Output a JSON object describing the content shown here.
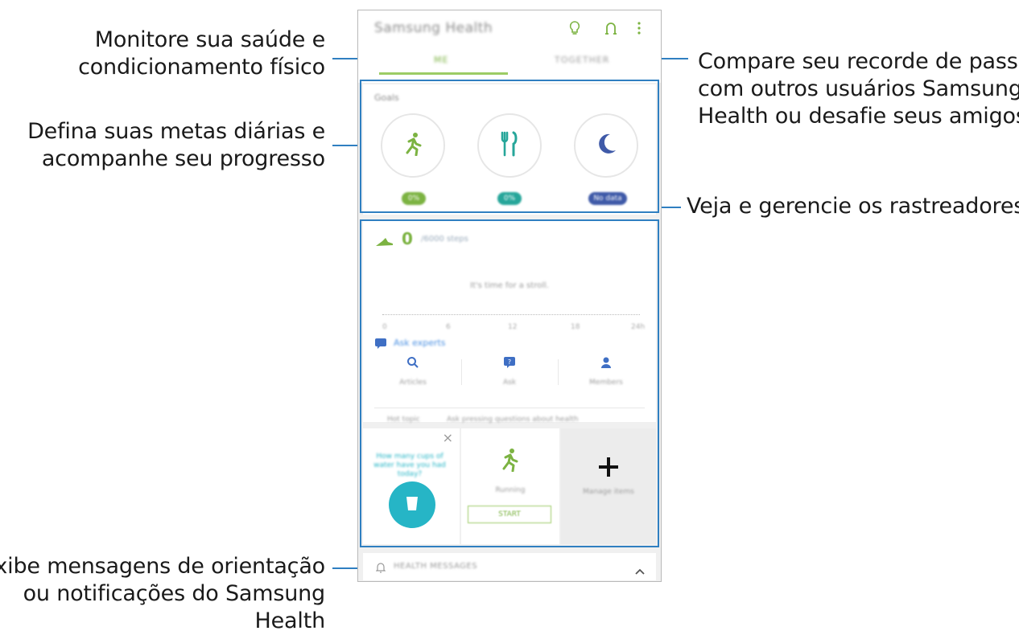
{
  "callouts": {
    "monitor": [
      "Monitore sua saúde e",
      "condicionamento físico"
    ],
    "goals": [
      "Defina suas metas diárias e",
      "acompanhe seu progresso"
    ],
    "messages": [
      "Exibe mensagens de orientação",
      "ou notificações do Samsung",
      "Health"
    ],
    "compare": [
      "Compare seu recorde de passos",
      "com outros usuários Samsung",
      "Health ou desafie seus amigos"
    ],
    "trackers": "Veja e gerencie os rastreadores"
  },
  "app": {
    "title": "Samsung Health",
    "tabs": [
      "ME",
      "TOGETHER"
    ]
  },
  "goals": {
    "title": "Goals",
    "badges": [
      {
        "label": "0%",
        "color": "#7cb342"
      },
      {
        "label": "0%",
        "color": "#26a69a"
      },
      {
        "label": "No data",
        "color": "#3f5aa8"
      }
    ]
  },
  "steps": {
    "value": "0",
    "target": "/6000 steps",
    "message": "It's time for a stroll.",
    "ticks": [
      "0",
      "6",
      "12",
      "18",
      "24h"
    ]
  },
  "experts": {
    "title": "Ask experts",
    "items": [
      "Articles",
      "Ask",
      "Members"
    ],
    "tags": [
      "Hot topic",
      "Ask pressing questions about health"
    ]
  },
  "trackers": {
    "water_prompt": "How many cups of water have you had today?",
    "running_label": "Running",
    "start_label": "START",
    "manage_label": "Manage items"
  },
  "messages": {
    "label": "HEALTH MESSAGES"
  },
  "colors": {
    "accent_green": "#7cb342",
    "water_teal": "#26b5c6",
    "sleep_blue": "#3f5aa8",
    "callout_blue": "#2f7fc1"
  }
}
